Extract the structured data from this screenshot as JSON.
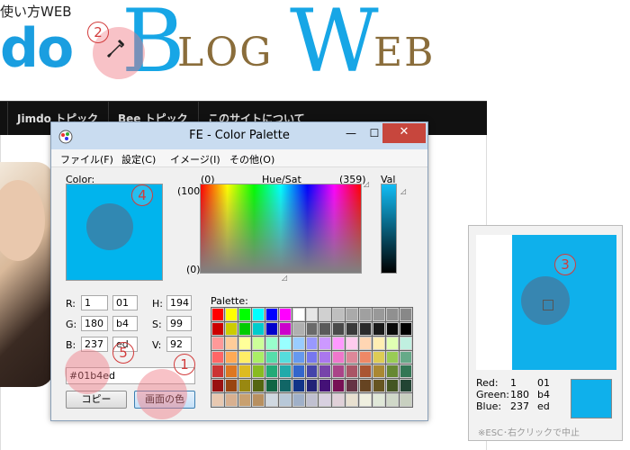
{
  "site": {
    "tagline": "使い方WEB",
    "logo_do": "do",
    "logo_B": "B",
    "logo_LOG": "LOG",
    "logo_W": "W",
    "logo_EB": "EB",
    "nav": [
      {
        "label": "Jimdo トピック"
      },
      {
        "label": "Bee トピック"
      },
      {
        "label": "このサイトについて"
      }
    ]
  },
  "window": {
    "title": "FE - Color Palette",
    "min_glyph": "—",
    "max_glyph": "☐",
    "close_glyph": "✕",
    "menu": [
      {
        "label": "ファイル(F)"
      },
      {
        "label": "設定(C)"
      },
      {
        "label": "イメージ(I)"
      },
      {
        "label": "その他(O)"
      }
    ],
    "color_label": "Color:",
    "huesat_label": "Hue/Sat",
    "hue_min": "(0)",
    "hue_max": "(359)",
    "sat_max": "(100)",
    "sat_min": "(0)",
    "val_label": "Val",
    "fields": {
      "r_label": "R:",
      "r": "1",
      "r_hex": "01",
      "g_label": "G:",
      "g": "180",
      "g_hex": "b4",
      "b_label": "B:",
      "b": "237",
      "b_hex": "ed",
      "h_label": "H:",
      "h": "194",
      "s_label": "S:",
      "s": "99",
      "v_label": "V:",
      "v": "92"
    },
    "hex_value": "#01b4ed",
    "copy_button": "コピー",
    "screen_color_button": "画面の色",
    "palette_label": "Palette:",
    "palette_rows": [
      [
        "#ff0000",
        "#ffff00",
        "#00ff00",
        "#00ffff",
        "#0000ff",
        "#ff00ff",
        "#ffffff",
        "#e6e6e6",
        "#d0d0d0",
        "#bfbfbf",
        "#aaaaaa",
        "#a0a0a0",
        "#999999",
        "#909090",
        "#888888"
      ],
      [
        "#cc0000",
        "#cccc00",
        "#00cc00",
        "#00cccc",
        "#0000cc",
        "#cc00cc",
        "#b0b0b0",
        "#6a6a6a",
        "#5a5a5a",
        "#4a4a4a",
        "#3a3a3a",
        "#2a2a2a",
        "#1a1a1a",
        "#0a0a0a",
        "#000000"
      ],
      [
        "#ff9999",
        "#ffcc99",
        "#ffff99",
        "#ccff99",
        "#99ffcc",
        "#99ffff",
        "#99ccff",
        "#9999ff",
        "#cc99ff",
        "#ff99ff",
        "#ffccee",
        "#ffd6b3",
        "#ffeeb3",
        "#e0ffb3",
        "#c0f0e0"
      ],
      [
        "#ff6666",
        "#ffaa55",
        "#ffee66",
        "#aaee66",
        "#55ddaa",
        "#55dddd",
        "#6699ee",
        "#7777ee",
        "#aa77ee",
        "#ee77cc",
        "#dd8899",
        "#ee8866",
        "#ddcc55",
        "#99cc55",
        "#66aa88"
      ],
      [
        "#cc3333",
        "#dd7722",
        "#ddbb22",
        "#88bb22",
        "#22aa77",
        "#22aaaa",
        "#3366cc",
        "#4444aa",
        "#7744aa",
        "#aa4488",
        "#aa5566",
        "#aa5533",
        "#aa8833",
        "#668833",
        "#337755"
      ],
      [
        "#991111",
        "#994411",
        "#998811",
        "#556611",
        "#116644",
        "#116666",
        "#113388",
        "#222277",
        "#441177",
        "#771155",
        "#663344",
        "#664422",
        "#665522",
        "#445522",
        "#224433"
      ],
      [
        "#e8c8b0",
        "#d8b090",
        "#c8a070",
        "#b89060",
        "#d0d8e0",
        "#b8c8d8",
        "#a0b0c8",
        "#c0c0d0",
        "#d8d0e0",
        "#e0d0d8",
        "#e8e0d0",
        "#f0f0e0",
        "#e0e8d8",
        "#d0d8c8",
        "#c8d0c0"
      ]
    ]
  },
  "zoom": {
    "red_label": "Red:",
    "red": "1",
    "red_hex": "01",
    "green_label": "Green:",
    "green": "180",
    "green_hex": "b4",
    "blue_label": "Blue:",
    "blue": "237",
    "blue_hex": "ed",
    "hint": "※ESC･右クリックで中止"
  },
  "markers": {
    "m1": "1",
    "m2": "2",
    "m3": "3",
    "m4": "4",
    "m5": "5"
  },
  "icons": {
    "dropper": "eyedropper-icon",
    "app": "palette-app-icon"
  }
}
